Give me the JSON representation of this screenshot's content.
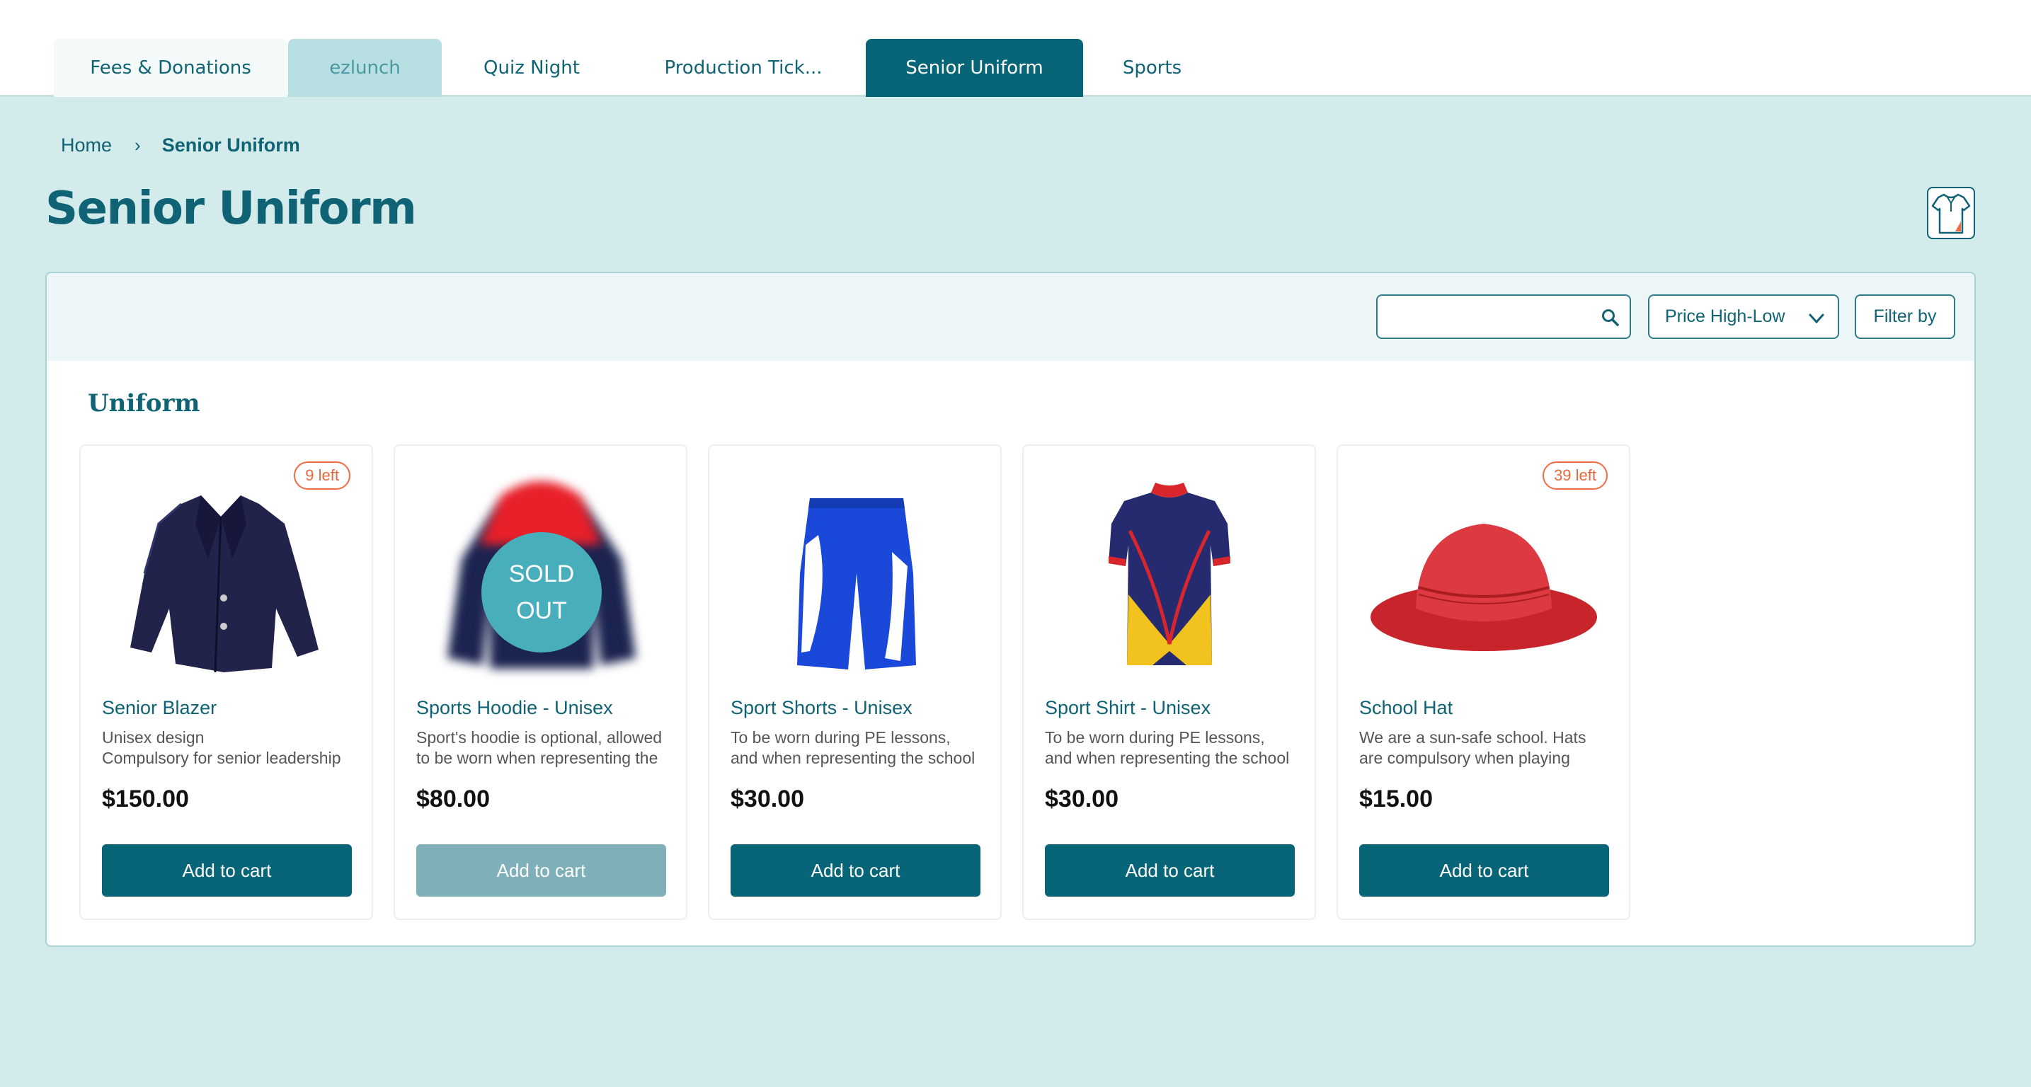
{
  "tabs": [
    {
      "label": "Fees & Donations"
    },
    {
      "label": "ezlunch"
    },
    {
      "label": "Quiz Night"
    },
    {
      "label": "Production Tick..."
    },
    {
      "label": "Senior Uniform",
      "active": true
    },
    {
      "label": "Sports"
    }
  ],
  "breadcrumb": {
    "home": "Home",
    "separator": "›",
    "current": "Senior Uniform"
  },
  "page_title": "Senior Uniform",
  "toolbar": {
    "search_placeholder": "",
    "sort_label": "Price High-Low",
    "filter_label": "Filter by"
  },
  "section_title": "Uniform",
  "products": [
    {
      "name": "Senior Blazer",
      "description": "Unisex design\nCompulsory for senior leadership team including prefects",
      "price": "$150.00",
      "stock_badge": "9 left",
      "button": "Add to cart",
      "image": "blazer-image"
    },
    {
      "name": "Sports Hoodie - Unisex",
      "description": "Sport's hoodie is optional, allowed to be worn when representing the school for sport teams",
      "price": "$80.00",
      "sold_out": [
        "SOLD",
        "OUT"
      ],
      "button": "Add to cart",
      "image": "hoodie-image"
    },
    {
      "name": "Sport Shorts - Unisex",
      "description": "To be worn during PE lessons, and when representing the school in sport teams",
      "price": "$30.00",
      "button": "Add to cart",
      "image": "shorts-image"
    },
    {
      "name": "Sport Shirt - Unisex",
      "description": "To be worn during PE lessons, and when representing the school in sport teams",
      "price": "$30.00",
      "button": "Add to cart",
      "image": "shirt-image"
    },
    {
      "name": "School Hat",
      "description": "We are a sun-safe school.  Hats are compulsory when playing outside at morning tea and lunch",
      "price": "$15.00",
      "stock_badge": "39 left",
      "button": "Add to cart",
      "image": "hat-image"
    }
  ],
  "colors": {
    "primary": "#086577",
    "background": "#d4ebeb",
    "badge": "#f36a43",
    "sold_out": "#48aebc"
  }
}
